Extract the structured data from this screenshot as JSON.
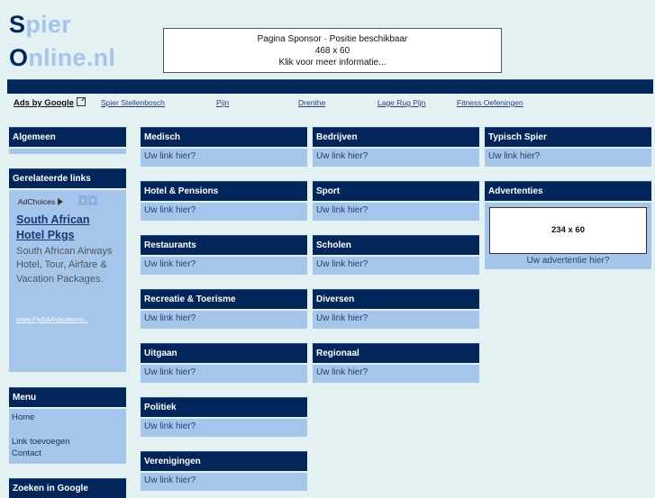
{
  "logo": {
    "line1_initial": "S",
    "line1_rest": "pier",
    "line2_initial": "O",
    "line2_rest": "nline.nl"
  },
  "banner": {
    "line1": "Pagina Sponsor · Positie beschikbaar",
    "line2": "468 x 60",
    "line3": "Klik voor meer informatie..."
  },
  "ads_row": {
    "label": "Ads by Google",
    "links": [
      "Spier Stellenbosch",
      "Pijn",
      "Drenthe",
      "Lage Rug Pijn",
      "Fitness Oefeningen"
    ]
  },
  "sidebar": {
    "algemeen": {
      "title": "Algemeen"
    },
    "related": {
      "title": "Gerelateerde links",
      "adchoices": "AdChoices",
      "ad_title": "South African Hotel Pkgs",
      "ad_desc": "South African Airways Hotel, Tour, Airfare & Vacation Packages.",
      "ad_url": "www.FlySAAVacations.."
    },
    "menu": {
      "title": "Menu",
      "items": [
        "Home",
        "Link toevoegen",
        "Contact"
      ]
    },
    "search": {
      "title": "Zoeken in Google"
    }
  },
  "categories": {
    "col1": [
      {
        "title": "Medisch",
        "link": "Uw link hier?"
      },
      {
        "title": "Hotel & Pensions",
        "link": "Uw link hier?"
      },
      {
        "title": "Restaurants",
        "link": "Uw link hier?"
      },
      {
        "title": "Recreatie & Toerisme",
        "link": "Uw link hier?"
      },
      {
        "title": "Uitgaan",
        "link": "Uw link hier?"
      },
      {
        "title": "Politiek",
        "link": "Uw link hier?"
      },
      {
        "title": "Verenigingen",
        "link": "Uw link hier?"
      }
    ],
    "col2": [
      {
        "title": "Bedrijven",
        "link": "Uw link hier?"
      },
      {
        "title": "Sport",
        "link": "Uw link hier?"
      },
      {
        "title": "Scholen",
        "link": "Uw link hier?"
      },
      {
        "title": "Diversen",
        "link": "Uw link hier?"
      },
      {
        "title": "Regionaal",
        "link": "Uw link hier?"
      }
    ],
    "col3": [
      {
        "title": "Typisch Spier",
        "link": "Uw link hier?"
      }
    ]
  },
  "advertenties": {
    "title": "Advertenties",
    "ad_size": "234 x 60",
    "link": "Uw advertentie hier?"
  },
  "colors": {
    "navy": "#03265a",
    "light_blue": "#a6c5ea",
    "background": "#e3f1f3"
  }
}
